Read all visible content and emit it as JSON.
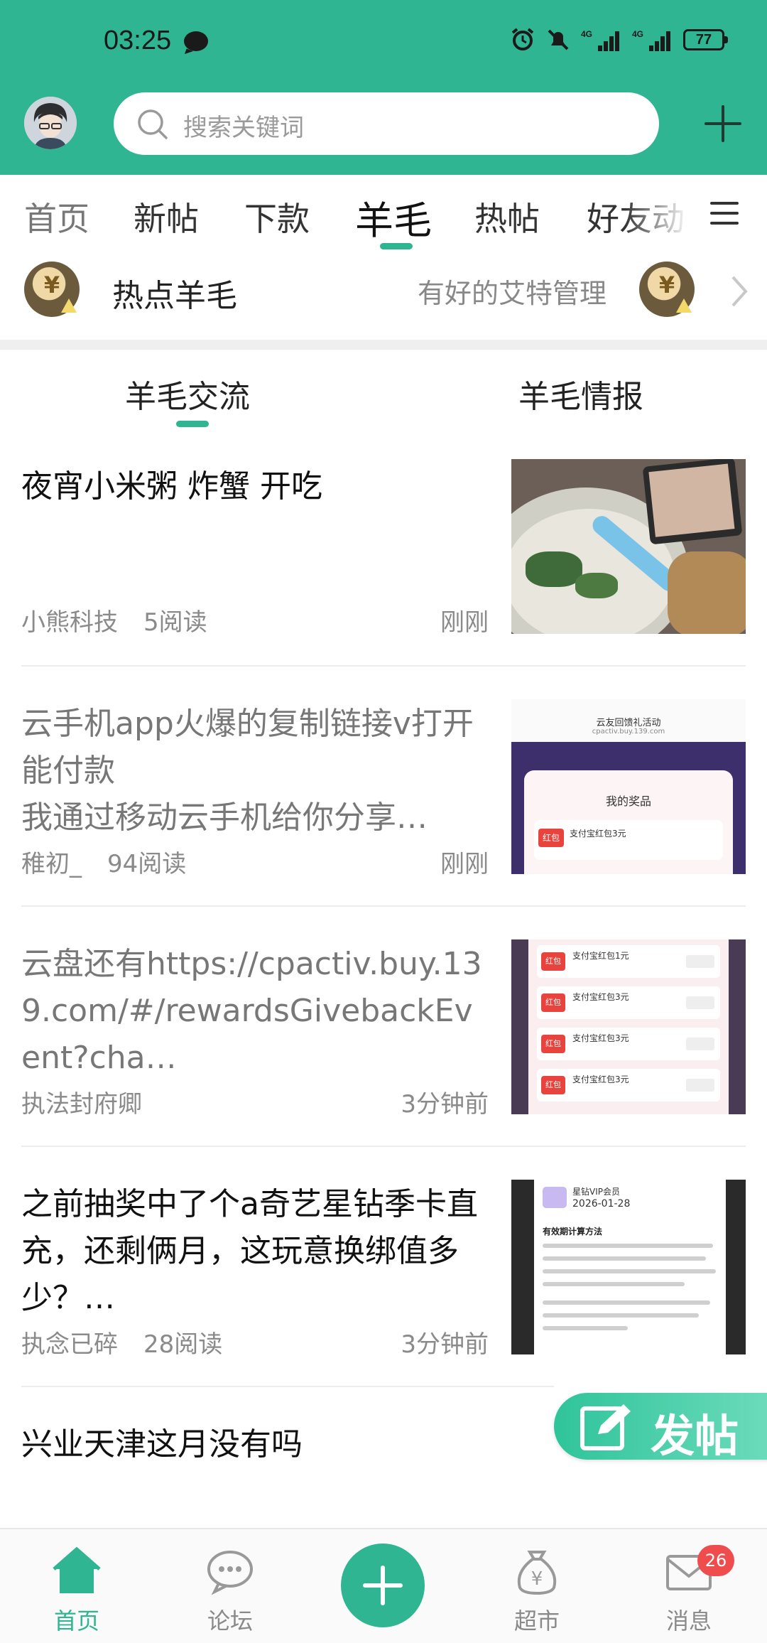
{
  "status_bar": {
    "time": "03:25",
    "battery": "77",
    "signal_1": "4G",
    "signal_2": "4G"
  },
  "header": {
    "search_placeholder": "搜索关键词"
  },
  "tabs": [
    {
      "label": "首页"
    },
    {
      "label": "新帖"
    },
    {
      "label": "下款"
    },
    {
      "label": "羊毛"
    },
    {
      "label": "热帖"
    },
    {
      "label": "好友动"
    }
  ],
  "hot": {
    "title": "热点羊毛",
    "right_text": "有好的艾特管理"
  },
  "subtabs": [
    {
      "label": "羊毛交流"
    },
    {
      "label": "羊毛情报"
    }
  ],
  "feed": [
    {
      "title": "夜宵小米粥 炸蟹 开吃",
      "author": "小熊科技",
      "reads": "5阅读",
      "time": "刚刚"
    },
    {
      "title": "云手机app火爆的复制链接v打开能付款",
      "summary": "我通过移动云手机给你分享…",
      "author": "稚初_",
      "reads": "94阅读",
      "time": "刚刚",
      "thumb": {
        "header": "云友回馈礼活动",
        "url": "cpactiv.buy.139.com",
        "panel_title": "我的奖品",
        "tag": "红包",
        "item": "支付宝红包3元"
      }
    },
    {
      "title": "云盘还有https://cpactiv.buy.139.com/#/rewardsGivebackEvent?cha…",
      "author": "执法封府卿",
      "time": "3分钟前",
      "thumb": {
        "tag": "红包",
        "items": [
          "支付宝红包1元",
          "支付宝红包3元",
          "支付宝红包3元",
          "支付宝红包3元"
        ]
      }
    },
    {
      "title": "之前抽奖中了个a奇艺星钻季卡直充，还剩俩月，这玩意换绑值多少？…",
      "author": "执念已碎",
      "reads": "28阅读",
      "time": "3分钟前",
      "thumb": {
        "title": "星钻VIP会员",
        "date": "2026-01-28",
        "heading": "有效期计算方法"
      }
    },
    {
      "title": "兴业天津这月没有吗"
    }
  ],
  "fab": {
    "label": "发帖"
  },
  "bottom_nav": [
    {
      "label": "首页",
      "icon": "home-icon"
    },
    {
      "label": "论坛",
      "icon": "chat-bubble-icon"
    },
    {
      "label": "",
      "icon": "plus-icon"
    },
    {
      "label": "超市",
      "icon": "money-bag-icon"
    },
    {
      "label": "消息",
      "icon": "mail-icon"
    }
  ],
  "message_badge": "26",
  "colors": {
    "brand": "#2fb592",
    "badge": "#ef4d4d"
  }
}
